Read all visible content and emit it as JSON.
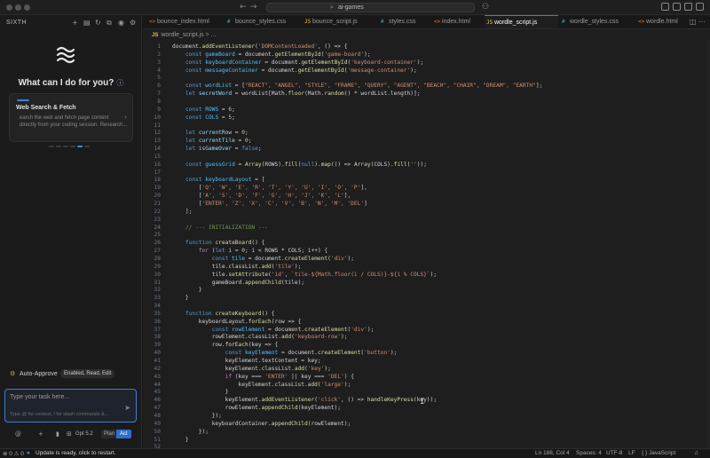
{
  "titlebar": {
    "search_text": "ai-games"
  },
  "leftpanel": {
    "title": "SIXTH",
    "headline": "What can I do for you?",
    "info_icon": "ⓘ",
    "card": {
      "title": "Web Search & Fetch",
      "description": "earch the web and fetch page content\ndirectly from your coding session. Research..."
    },
    "auto_approve": {
      "label": "Auto-Approve",
      "pill": "Enabled, Read, Edit"
    },
    "input": {
      "placeholder": "Type your task here...",
      "hint": "Type @ for context, / for slash commands &..."
    },
    "model": "Gpt 5.2",
    "plan": "Plan",
    "act": "Act"
  },
  "editor": {
    "tabs": [
      {
        "label": "bounce_index.html",
        "icon": "<>",
        "color": "#e37933"
      },
      {
        "label": "bounce_styles.css",
        "icon": "#",
        "color": "#519aba"
      },
      {
        "label": "bounce_script.js",
        "icon": "JS",
        "color": "#e3c34d"
      },
      {
        "label": "styles.css",
        "icon": "#",
        "color": "#519aba"
      },
      {
        "label": "index.html",
        "icon": "<>",
        "color": "#e37933"
      },
      {
        "label": "wordle_script.js",
        "icon": "JS",
        "color": "#e3c34d",
        "active": true
      },
      {
        "label": "wordle_styles.css",
        "icon": "#",
        "color": "#519aba"
      },
      {
        "label": "wordle.html",
        "icon": "<>",
        "color": "#e37933"
      }
    ],
    "breadcrumb_file": "wordle_script.js",
    "breadcrumb_rest": "> ...",
    "code_lines": [
      [
        [
          "document.",
          "p"
        ],
        [
          "addEventListener",
          "f"
        ],
        [
          "(",
          "p"
        ],
        [
          "'DOMContentLoaded'",
          "s"
        ],
        [
          ", () => {",
          "p"
        ]
      ],
      [
        [
          "    ",
          "p"
        ],
        [
          "const ",
          "k"
        ],
        [
          "gameBoard",
          "cn"
        ],
        [
          " = document.",
          "p"
        ],
        [
          "getElementById",
          "f"
        ],
        [
          "(",
          "p"
        ],
        [
          "'game-board'",
          "s"
        ],
        [
          ");",
          "p"
        ]
      ],
      [
        [
          "    ",
          "p"
        ],
        [
          "const ",
          "k"
        ],
        [
          "keyboardContainer",
          "cn"
        ],
        [
          " = document.",
          "p"
        ],
        [
          "getElementById",
          "f"
        ],
        [
          "(",
          "p"
        ],
        [
          "'keyboard-container'",
          "s"
        ],
        [
          ");",
          "p"
        ]
      ],
      [
        [
          "    ",
          "p"
        ],
        [
          "const ",
          "k"
        ],
        [
          "messageContainer",
          "cn"
        ],
        [
          " = document.",
          "p"
        ],
        [
          "getElementById",
          "f"
        ],
        [
          "(",
          "p"
        ],
        [
          "'message-container'",
          "s"
        ],
        [
          ");",
          "p"
        ]
      ],
      [
        [
          "",
          "p"
        ]
      ],
      [
        [
          "    ",
          "p"
        ],
        [
          "const ",
          "k"
        ],
        [
          "wordList",
          "cn"
        ],
        [
          " = [",
          "p"
        ],
        [
          "\"REACT\", \"ANGEL\", \"STYLE\", \"FRAME\", \"QUERY\", \"AGENT\", \"BEACH\", \"CHAIR\", \"DREAM\", \"EARTH\"",
          "s"
        ],
        [
          "];",
          "p"
        ]
      ],
      [
        [
          "    ",
          "p"
        ],
        [
          "let ",
          "k"
        ],
        [
          "secretWord",
          "v"
        ],
        [
          " = wordList[Math.",
          "p"
        ],
        [
          "floor",
          "f"
        ],
        [
          "(Math.",
          "p"
        ],
        [
          "random",
          "f"
        ],
        [
          "() * wordList.length)];",
          "p"
        ]
      ],
      [
        [
          "",
          "p"
        ]
      ],
      [
        [
          "    ",
          "p"
        ],
        [
          "const ",
          "k"
        ],
        [
          "ROWS",
          "cn"
        ],
        [
          " = ",
          "p"
        ],
        [
          "6",
          "n"
        ],
        [
          ";",
          "p"
        ]
      ],
      [
        [
          "    ",
          "p"
        ],
        [
          "const ",
          "k"
        ],
        [
          "COLS",
          "cn"
        ],
        [
          " = ",
          "p"
        ],
        [
          "5",
          "n"
        ],
        [
          ";",
          "p"
        ]
      ],
      [
        [
          "",
          "p"
        ]
      ],
      [
        [
          "    ",
          "p"
        ],
        [
          "let ",
          "k"
        ],
        [
          "currentRow",
          "v"
        ],
        [
          " = ",
          "p"
        ],
        [
          "0",
          "n"
        ],
        [
          ";",
          "p"
        ]
      ],
      [
        [
          "    ",
          "p"
        ],
        [
          "let ",
          "k"
        ],
        [
          "currentTile",
          "v"
        ],
        [
          " = ",
          "p"
        ],
        [
          "0",
          "n"
        ],
        [
          ";",
          "p"
        ]
      ],
      [
        [
          "    ",
          "p"
        ],
        [
          "let ",
          "k"
        ],
        [
          "isGameOver",
          "v"
        ],
        [
          " = ",
          "p"
        ],
        [
          "false",
          "k"
        ],
        [
          ";",
          "p"
        ]
      ],
      [
        [
          "",
          "p"
        ]
      ],
      [
        [
          "    ",
          "p"
        ],
        [
          "const ",
          "k"
        ],
        [
          "guessGrid",
          "cn"
        ],
        [
          " = ",
          "p"
        ],
        [
          "Array",
          "f"
        ],
        [
          "(ROWS).",
          "p"
        ],
        [
          "fill",
          "f"
        ],
        [
          "(",
          "p"
        ],
        [
          "null",
          "k"
        ],
        [
          ").",
          "p"
        ],
        [
          "map",
          "f"
        ],
        [
          "(() => ",
          "p"
        ],
        [
          "Array",
          "f"
        ],
        [
          "(COLS).",
          "p"
        ],
        [
          "fill",
          "f"
        ],
        [
          "(",
          "p"
        ],
        [
          "''",
          "s"
        ],
        [
          "));",
          "p"
        ]
      ],
      [
        [
          "",
          "p"
        ]
      ],
      [
        [
          "    ",
          "p"
        ],
        [
          "const ",
          "k"
        ],
        [
          "keyboardLayout",
          "cn"
        ],
        [
          " = [",
          "p"
        ]
      ],
      [
        [
          "        [",
          "p"
        ],
        [
          "'Q', 'W', 'E', 'R', 'T', 'Y', 'U', 'I', 'O', 'P'",
          "s"
        ],
        [
          "],",
          "p"
        ]
      ],
      [
        [
          "        [",
          "p"
        ],
        [
          "'A', 'S', 'D', 'F', 'G', 'H', 'J', 'K', 'L'",
          "s"
        ],
        [
          "],",
          "p"
        ]
      ],
      [
        [
          "        [",
          "p"
        ],
        [
          "'ENTER', 'Z', 'X', 'C', 'V', 'B', 'N', 'M', 'DEL'",
          "s"
        ],
        [
          "]",
          "p"
        ]
      ],
      [
        [
          "    ];",
          "p"
        ]
      ],
      [
        [
          "",
          "p"
        ]
      ],
      [
        [
          "    ",
          "p"
        ],
        [
          "// --- INITIALIZATION ---",
          "c"
        ]
      ],
      [
        [
          "",
          "p"
        ]
      ],
      [
        [
          "    ",
          "p"
        ],
        [
          "function ",
          "k"
        ],
        [
          "createBoard",
          "f"
        ],
        [
          "() {",
          "p"
        ]
      ],
      [
        [
          "        ",
          "p"
        ],
        [
          "for ",
          "kw"
        ],
        [
          "(",
          "p"
        ],
        [
          "let ",
          "k"
        ],
        [
          "i",
          "v"
        ],
        [
          " = ",
          "p"
        ],
        [
          "0",
          "n"
        ],
        [
          "; i < ROWS * COLS; i++) {",
          "p"
        ]
      ],
      [
        [
          "            ",
          "p"
        ],
        [
          "const ",
          "k"
        ],
        [
          "tile",
          "cn"
        ],
        [
          " = document.",
          "p"
        ],
        [
          "createElement",
          "f"
        ],
        [
          "(",
          "p"
        ],
        [
          "'div'",
          "s"
        ],
        [
          ");",
          "p"
        ]
      ],
      [
        [
          "            tile.classList.",
          "p"
        ],
        [
          "add",
          "f"
        ],
        [
          "(",
          "p"
        ],
        [
          "'tile'",
          "s"
        ],
        [
          ");",
          "p"
        ]
      ],
      [
        [
          "            tile.",
          "p"
        ],
        [
          "setAttribute",
          "f"
        ],
        [
          "(",
          "p"
        ],
        [
          "'id'",
          "s"
        ],
        [
          ", ",
          "p"
        ],
        [
          "`tile-${Math.floor(i / COLS)}-${i % COLS}`",
          "s"
        ],
        [
          ");",
          "p"
        ]
      ],
      [
        [
          "            gameBoard.",
          "p"
        ],
        [
          "appendChild",
          "f"
        ],
        [
          "(tile);",
          "p"
        ]
      ],
      [
        [
          "        }",
          "p"
        ]
      ],
      [
        [
          "    }",
          "p"
        ]
      ],
      [
        [
          "",
          "p"
        ]
      ],
      [
        [
          "    ",
          "p"
        ],
        [
          "function ",
          "k"
        ],
        [
          "createKeyboard",
          "f"
        ],
        [
          "() {",
          "p"
        ]
      ],
      [
        [
          "        keyboardLayout.",
          "p"
        ],
        [
          "forEach",
          "f"
        ],
        [
          "(row => {",
          "p"
        ]
      ],
      [
        [
          "            ",
          "p"
        ],
        [
          "const ",
          "k"
        ],
        [
          "rowElement",
          "cn"
        ],
        [
          " = document.",
          "p"
        ],
        [
          "createElement",
          "f"
        ],
        [
          "(",
          "p"
        ],
        [
          "'div'",
          "s"
        ],
        [
          ");",
          "p"
        ]
      ],
      [
        [
          "            rowElement.classList.",
          "p"
        ],
        [
          "add",
          "f"
        ],
        [
          "(",
          "p"
        ],
        [
          "'keyboard-row'",
          "s"
        ],
        [
          ");",
          "p"
        ]
      ],
      [
        [
          "            row.",
          "p"
        ],
        [
          "forEach",
          "f"
        ],
        [
          "(key => {",
          "p"
        ]
      ],
      [
        [
          "                ",
          "p"
        ],
        [
          "const ",
          "k"
        ],
        [
          "keyElement",
          "cn"
        ],
        [
          " = document.",
          "p"
        ],
        [
          "createElement",
          "f"
        ],
        [
          "(",
          "p"
        ],
        [
          "'button'",
          "s"
        ],
        [
          ");",
          "p"
        ]
      ],
      [
        [
          "                keyElement.textContent = key;",
          "p"
        ]
      ],
      [
        [
          "                keyElement.classList.",
          "p"
        ],
        [
          "add",
          "f"
        ],
        [
          "(",
          "p"
        ],
        [
          "'key'",
          "s"
        ],
        [
          ");",
          "p"
        ]
      ],
      [
        [
          "                ",
          "p"
        ],
        [
          "if ",
          "kw"
        ],
        [
          "(key === ",
          "p"
        ],
        [
          "'ENTER'",
          "s"
        ],
        [
          " || key === ",
          "p"
        ],
        [
          "'DEL'",
          "s"
        ],
        [
          ") {",
          "p"
        ]
      ],
      [
        [
          "                    keyElement.classList.",
          "p"
        ],
        [
          "add",
          "f"
        ],
        [
          "(",
          "p"
        ],
        [
          "'large'",
          "s"
        ],
        [
          ");",
          "p"
        ]
      ],
      [
        [
          "                }",
          "p"
        ]
      ],
      [
        [
          "                keyElement.",
          "p"
        ],
        [
          "addEventListener",
          "f"
        ],
        [
          "(",
          "p"
        ],
        [
          "'click'",
          "s"
        ],
        [
          ", () => ",
          "p"
        ],
        [
          "handleKeyPress",
          "f"
        ],
        [
          "(key));",
          "p"
        ]
      ],
      [
        [
          "                rowElement.",
          "p"
        ],
        [
          "appendChild",
          "f"
        ],
        [
          "(keyElement);",
          "p"
        ]
      ],
      [
        [
          "            });",
          "p"
        ]
      ],
      [
        [
          "            keyboardContainer.",
          "p"
        ],
        [
          "appendChild",
          "f"
        ],
        [
          "(rowElement);",
          "p"
        ]
      ],
      [
        [
          "        });",
          "p"
        ]
      ],
      [
        [
          "    }",
          "p"
        ]
      ],
      [
        [
          "",
          "p"
        ]
      ]
    ]
  },
  "statusbar": {
    "left_icon": "⊗ 0 ⚠ 0",
    "update": "Update is ready, click to restart.",
    "position": "Ln 188, Col 4",
    "spaces": "Spaces: 4",
    "encoding": "UTF-8",
    "eol": "LF",
    "language": "{ } JavaScript"
  }
}
